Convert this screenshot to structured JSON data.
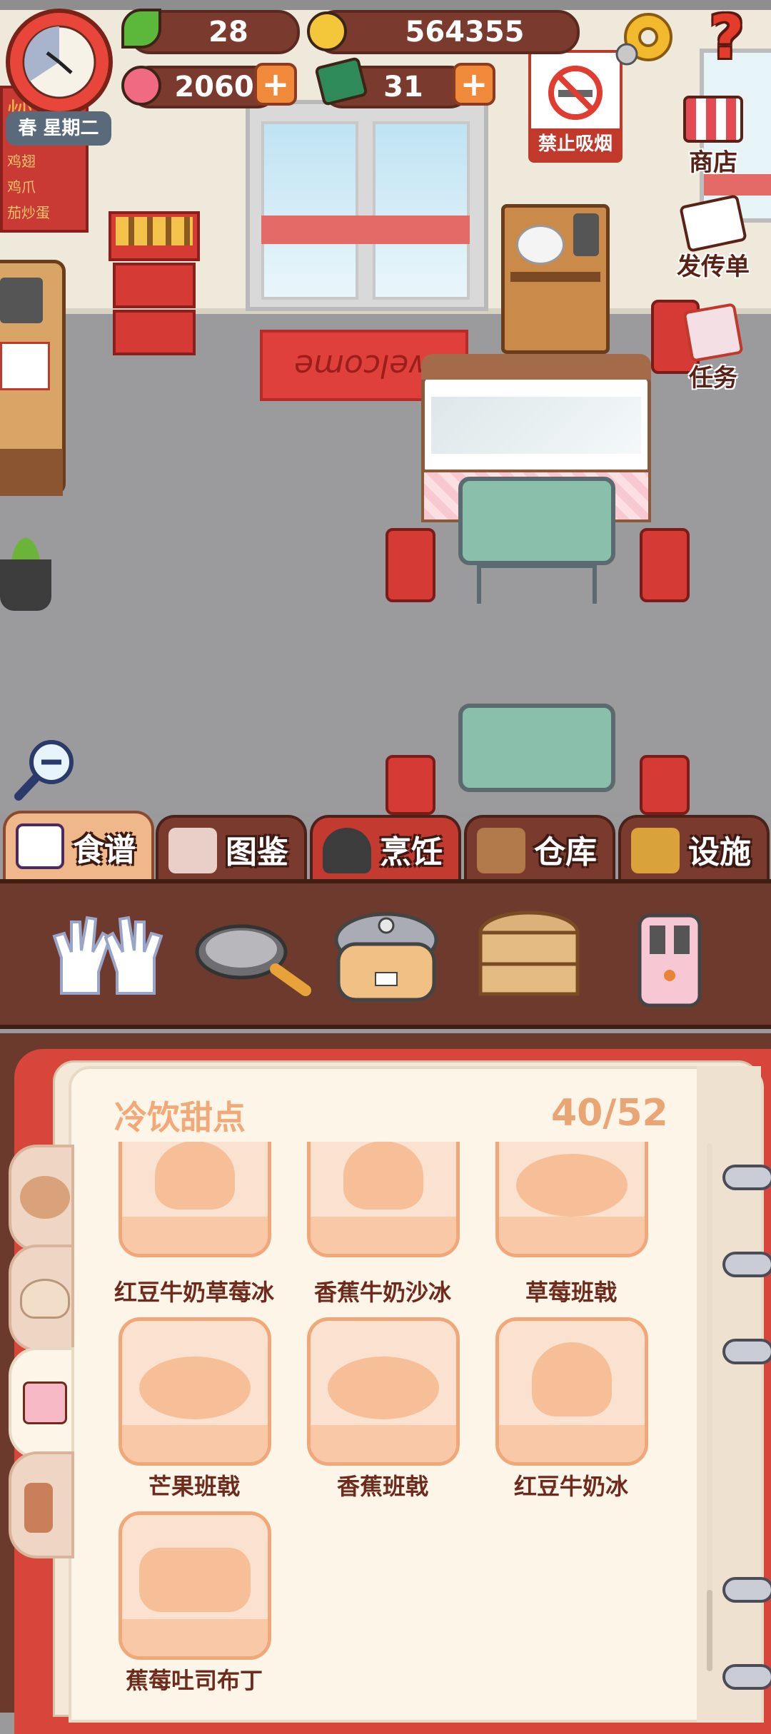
{
  "hud": {
    "leaf_count": "28",
    "coin_count": "564355",
    "heart_count": "2060",
    "book_count": "31",
    "season_day": "春 星期二",
    "plus_symbol": "+",
    "help_symbol": "?"
  },
  "scene": {
    "no_smoking_sign": "禁止吸烟",
    "welcome_mat": "welcome",
    "menu_board": [
      "炒",
      "鸡翅",
      "鸡爪",
      "茄炒蛋"
    ]
  },
  "side_menu": [
    {
      "label": "商店",
      "icon": "shop-icon"
    },
    {
      "label": "发传单",
      "icon": "flyer-icon"
    },
    {
      "label": "任务",
      "icon": "task-icon"
    }
  ],
  "tabs": [
    {
      "label": "食谱",
      "icon": "recipe-book-icon",
      "active": true
    },
    {
      "label": "图鉴",
      "icon": "characters-icon",
      "active": false
    },
    {
      "label": "烹饪",
      "icon": "cooking-pot-icon",
      "active": false
    },
    {
      "label": "仓库",
      "icon": "storage-shelf-icon",
      "active": false
    },
    {
      "label": "设施",
      "icon": "facility-chair-icon",
      "active": false
    }
  ],
  "tools": [
    "gloves-icon",
    "frying-pan-icon",
    "rice-cooker-icon",
    "steamer-icon",
    "toaster-icon"
  ],
  "recipe_book": {
    "category": "冷饮甜点",
    "progress": "40/52",
    "items": [
      {
        "name": "红豆牛奶草莓冰",
        "shape": "cup"
      },
      {
        "name": "香蕉牛奶沙冰",
        "shape": "cup"
      },
      {
        "name": "草莓班戟",
        "shape": "oval"
      },
      {
        "name": "芒果班戟",
        "shape": "oval"
      },
      {
        "name": "香蕉班戟",
        "shape": "oval"
      },
      {
        "name": "红豆牛奶冰",
        "shape": "cup"
      },
      {
        "name": "蕉莓吐司布丁",
        "shape": "toast"
      }
    ]
  },
  "colors": {
    "accent_orange": "#f08a3a",
    "pill_brown": "#7a3b2e",
    "book_red": "#d8453a",
    "title_orange": "#f2a877",
    "label_brown": "#6e2b1c"
  }
}
